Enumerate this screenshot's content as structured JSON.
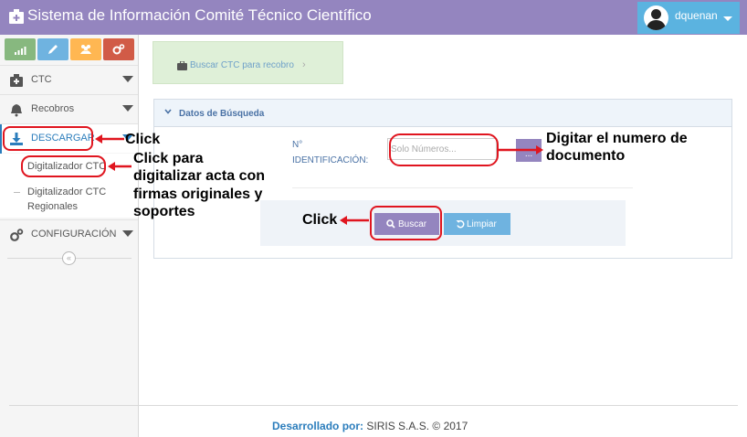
{
  "app": {
    "title": "Sistema de Información Comité Técnico Científico"
  },
  "user": {
    "name": "dquenan"
  },
  "sidebar": {
    "shortcuts": [
      {
        "icon": "signal-icon",
        "color": "#87b87f"
      },
      {
        "icon": "pencil-icon",
        "color": "#6fb3e0"
      },
      {
        "icon": "users-icon",
        "color": "#ffb752"
      },
      {
        "icon": "cogs-icon",
        "color": "#d15b47"
      }
    ],
    "items": [
      {
        "label": "CTC",
        "icon": "hospital-icon"
      },
      {
        "label": "Recobros",
        "icon": "bell-icon"
      },
      {
        "label": "DESCARGAR",
        "icon": "download-icon"
      },
      {
        "label": "CONFIGURACIÓN",
        "icon": "cogs-icon"
      }
    ],
    "subitems": [
      {
        "label": "Digitalizador CTC"
      },
      {
        "label_line1": "Digitalizador CTC",
        "label_line2": "Regionales"
      }
    ],
    "collapse_glyph": "«"
  },
  "breadcrumb": {
    "label": "Buscar CTC para recobro"
  },
  "panel": {
    "title": "Datos de Búsqueda",
    "field_label_line1": "N°",
    "field_label_line2": "IDENTIFICACIÓN:",
    "input_placeholder": "Solo Números...",
    "lookup_button": "...",
    "search_button": "Buscar",
    "clear_button": "Limpiar"
  },
  "annotations": {
    "click_descargar": "Click",
    "click_digitalizar_line1": "Click para",
    "click_digitalizar_line2": "digitalizar acta con",
    "click_digitalizar_line3": "firmas originales y",
    "click_digitalizar_line4": "soportes",
    "digitar_line1": "Digitar el numero de",
    "digitar_line2": "documento",
    "click_buscar": "Click",
    "ring_color": "#e0151f"
  },
  "footer": {
    "prefix": "Desarrollado por:",
    "text": "SIRIS S.A.S. © 2017"
  },
  "colors": {
    "header": "#9485bf",
    "user_box": "#5bb3e0",
    "accent": "#2b7dbc"
  }
}
